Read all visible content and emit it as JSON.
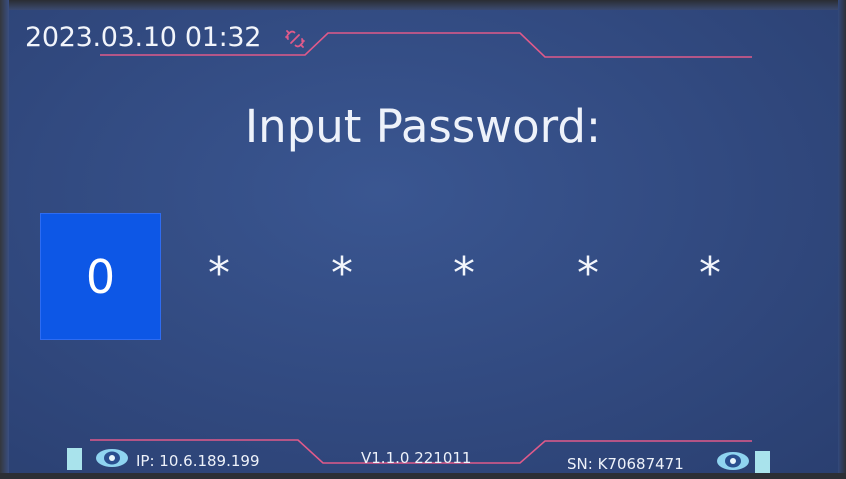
{
  "status_bar": {
    "datetime": "2023.03.10 01:32",
    "link_icon": "broken-link-icon"
  },
  "prompt": {
    "title": "Input Password:"
  },
  "password": {
    "current_digit": "0",
    "masked": [
      "*",
      "*",
      "*",
      "*",
      "*"
    ]
  },
  "footer": {
    "ip": "IP: 10.6.189.199",
    "version": "V1.1.0 221011",
    "sn": "SN: K70687471",
    "left_icon": "eye-icon",
    "right_icon": "eye-icon"
  },
  "colors": {
    "background": "#31497f",
    "selected_digit": "#0d57e6",
    "accent_line": "#e05a8a",
    "battery": "#a9e3ec"
  }
}
